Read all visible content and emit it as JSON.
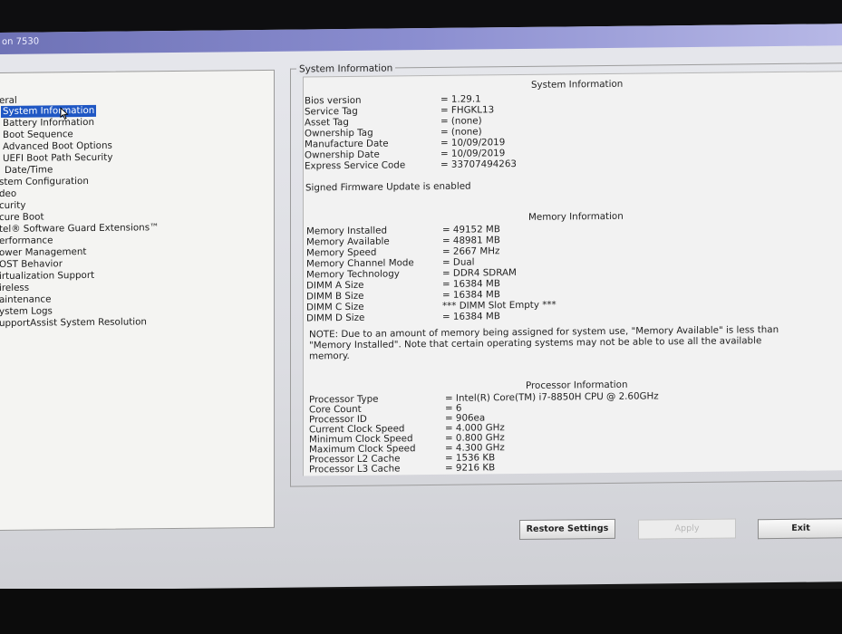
{
  "window": {
    "title": "on 7530"
  },
  "nav": {
    "items": [
      {
        "label": "",
        "selected": false
      },
      {
        "label": "eral",
        "selected": false
      },
      {
        "label": "System Information",
        "selected": true
      },
      {
        "label": "Battery Information",
        "selected": false
      },
      {
        "label": "Boot Sequence",
        "selected": false
      },
      {
        "label": "Advanced Boot Options",
        "selected": false
      },
      {
        "label": "UEFI Boot Path Security",
        "selected": false
      },
      {
        "label": "Date/Time",
        "selected": false
      },
      {
        "label": "stem Configuration",
        "selected": false
      },
      {
        "label": "deo",
        "selected": false
      },
      {
        "label": "curity",
        "selected": false
      },
      {
        "label": "cure Boot",
        "selected": false
      },
      {
        "label": "tel® Software Guard Extensions™",
        "selected": false
      },
      {
        "label": "erformance",
        "selected": false
      },
      {
        "label": "ower Management",
        "selected": false
      },
      {
        "label": "OST Behavior",
        "selected": false
      },
      {
        "label": "irtualization Support",
        "selected": false
      },
      {
        "label": "ireless",
        "selected": false
      },
      {
        "label": "aintenance",
        "selected": false
      },
      {
        "label": "ystem Logs",
        "selected": false
      },
      {
        "label": "upportAssist System Resolution",
        "selected": false
      }
    ]
  },
  "group_title": "System Information",
  "system": {
    "heading": "System Information",
    "rows": [
      {
        "label": "Bios version",
        "value": "= 1.29.1"
      },
      {
        "label": "Service Tag",
        "value": "= FHGKL13"
      },
      {
        "label": "Asset Tag",
        "value": "= (none)"
      },
      {
        "label": "Ownership Tag",
        "value": "= (none)"
      },
      {
        "label": "Manufacture Date",
        "value": "= 10/09/2019"
      },
      {
        "label": "Ownership Date",
        "value": "= 10/09/2019"
      },
      {
        "label": "Express Service Code",
        "value": "= 33707494263"
      }
    ],
    "firmware_note": "Signed Firmware Update is enabled"
  },
  "memory": {
    "heading": "Memory Information",
    "rows": [
      {
        "label": "Memory Installed",
        "value": "= 49152 MB"
      },
      {
        "label": "Memory Available",
        "value": "= 48981 MB"
      },
      {
        "label": "Memory Speed",
        "value": "= 2667 MHz"
      },
      {
        "label": "Memory Channel Mode",
        "value": "= Dual"
      },
      {
        "label": "Memory Technology",
        "value": "= DDR4 SDRAM"
      },
      {
        "label": "DIMM A Size",
        "value": "= 16384 MB"
      },
      {
        "label": "DIMM B Size",
        "value": "= 16384 MB"
      },
      {
        "label": "DIMM C Size",
        "value": "*** DIMM Slot Empty ***"
      },
      {
        "label": "DIMM D Size",
        "value": "= 16384 MB"
      }
    ],
    "note": "NOTE: Due to an amount of memory being assigned for system use, \"Memory Available\" is less than \"Memory Installed\". Note that certain operating systems may not be able to use all the available memory."
  },
  "processor": {
    "heading": "Processor Information",
    "rows": [
      {
        "label": "Processor Type",
        "value": "= Intel(R) Core(TM) i7-8850H CPU @ 2.60GHz"
      },
      {
        "label": "Core Count",
        "value": "= 6"
      },
      {
        "label": "Processor ID",
        "value": "= 906ea"
      },
      {
        "label": "Current Clock Speed",
        "value": "= 4.000 GHz"
      },
      {
        "label": "Minimum Clock Speed",
        "value": "= 0.800 GHz"
      },
      {
        "label": "Maximum Clock Speed",
        "value": "= 4.300 GHz"
      },
      {
        "label": "Processor L2 Cache",
        "value": "= 1536 KB"
      },
      {
        "label": "Processor L3 Cache",
        "value": "= 9216 KB"
      }
    ]
  },
  "buttons": {
    "restore": "Restore Settings",
    "apply": "Apply",
    "exit": "Exit"
  },
  "colors": {
    "selection": "#1f57c4",
    "titlebar": "#7a7ec4"
  }
}
